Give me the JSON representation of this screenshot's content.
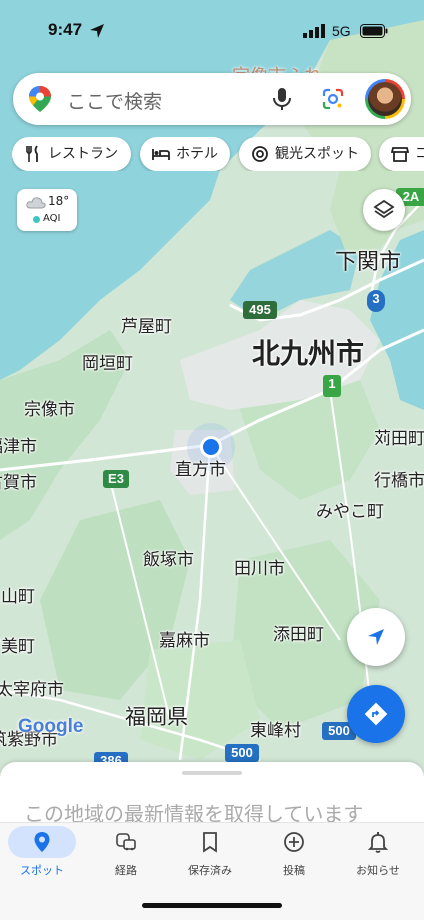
{
  "status": {
    "time": "9:47",
    "network": "5G"
  },
  "search": {
    "placeholder": "ここで検索"
  },
  "chips": [
    {
      "label": "レストラン",
      "icon": "fork-knife-icon"
    },
    {
      "label": "ホテル",
      "icon": "bed-icon"
    },
    {
      "label": "観光スポット",
      "icon": "camera-icon"
    },
    {
      "label": "コ",
      "icon": "shop-icon"
    }
  ],
  "weather": {
    "temp": "18°",
    "aqi": "AQI"
  },
  "map": {
    "labels": {
      "shimonoseki": "下関市",
      "kitakyushu": "北九州市",
      "ashiya": "芦屋町",
      "okagaki": "岡垣町",
      "munakata": "宗像市",
      "fukutsu": "福津市",
      "koga": "古賀市",
      "nogata": "直方市",
      "kanda": "苅田町",
      "yukuhashi": "行橋市",
      "miyako": "みやこ町",
      "iizuka": "飯塚市",
      "tagawa": "田川市",
      "kasuya": "久山町",
      "umi": "宇美町",
      "kama": "嘉麻市",
      "soeda": "添田町",
      "dazaifu": "太宰府市",
      "fukuoka_pref": "福岡県",
      "chikushino": "筑紫野市",
      "toho": "東峰村",
      "top_partial": "宗像市ふれ"
    },
    "roads": [
      "495",
      "1",
      "3",
      "2A",
      "E3",
      "500",
      "500",
      "386"
    ],
    "brand": "Google"
  },
  "sheet": {
    "message": "この地域の最新情報を取得しています"
  },
  "nav": [
    {
      "label": "スポット",
      "icon": "location-pin-icon",
      "active": true
    },
    {
      "label": "経路",
      "icon": "commute-icon",
      "active": false
    },
    {
      "label": "保存済み",
      "icon": "bookmark-icon",
      "active": false
    },
    {
      "label": "投稿",
      "icon": "add-circle-icon",
      "active": false
    },
    {
      "label": "お知らせ",
      "icon": "bell-icon",
      "active": false
    }
  ],
  "colors": {
    "accent": "#1a73e8",
    "water": "#8fd3dc",
    "land": "#cfe3d2",
    "road": "#ffffff"
  }
}
